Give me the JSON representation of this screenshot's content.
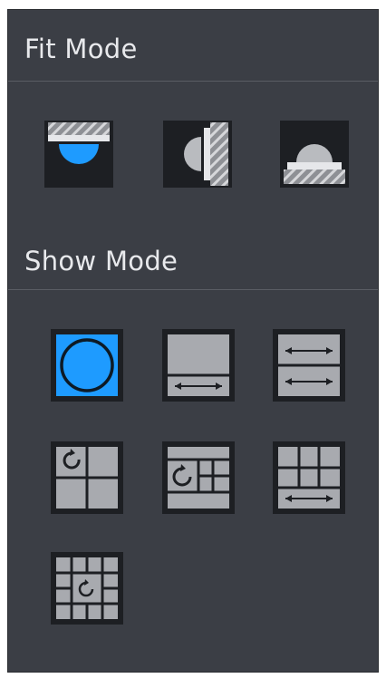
{
  "fit_mode": {
    "title": "Fit Mode",
    "buttons": [
      {
        "name": "ceiling",
        "icon": "ceiling-mount-icon"
      },
      {
        "name": "wall",
        "icon": "wall-mount-icon"
      },
      {
        "name": "ground",
        "icon": "ground-mount-icon"
      }
    ]
  },
  "show_mode": {
    "title": "Show Mode",
    "selected": "original-circle",
    "buttons": [
      {
        "name": "original-circle",
        "icon": "fisheye-circle-icon",
        "selected": true
      },
      {
        "name": "panorama-1",
        "icon": "single-panorama-icon"
      },
      {
        "name": "panorama-2",
        "icon": "dual-panorama-icon"
      },
      {
        "name": "circle-3-split",
        "icon": "fisheye-plus-3-icon"
      },
      {
        "name": "circle-4-split",
        "icon": "fisheye-plus-4-icon"
      },
      {
        "name": "panorama-6-split",
        "icon": "panorama-plus-6-icon"
      },
      {
        "name": "circle-8-split",
        "icon": "fisheye-plus-8-icon"
      }
    ]
  },
  "colors": {
    "panel_bg": "#3b3e45",
    "selected": "#1e9bff",
    "tile": "#a8aaaf",
    "tile_dark": "#1d1f23"
  }
}
